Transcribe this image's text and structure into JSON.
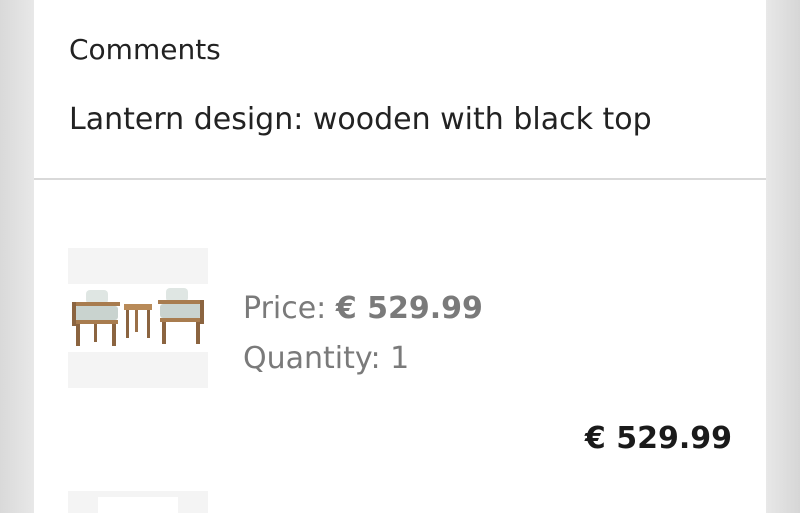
{
  "comments": {
    "label": "Comments",
    "text": "Lantern design: wooden with black top"
  },
  "cart_item": {
    "image_icon": "garden-furniture-set-image",
    "price_label": "Price: ",
    "price_value": "€ 529.99",
    "quantity_label": "Quantity: ",
    "quantity_value": "1",
    "line_total": "€ 529.99"
  }
}
